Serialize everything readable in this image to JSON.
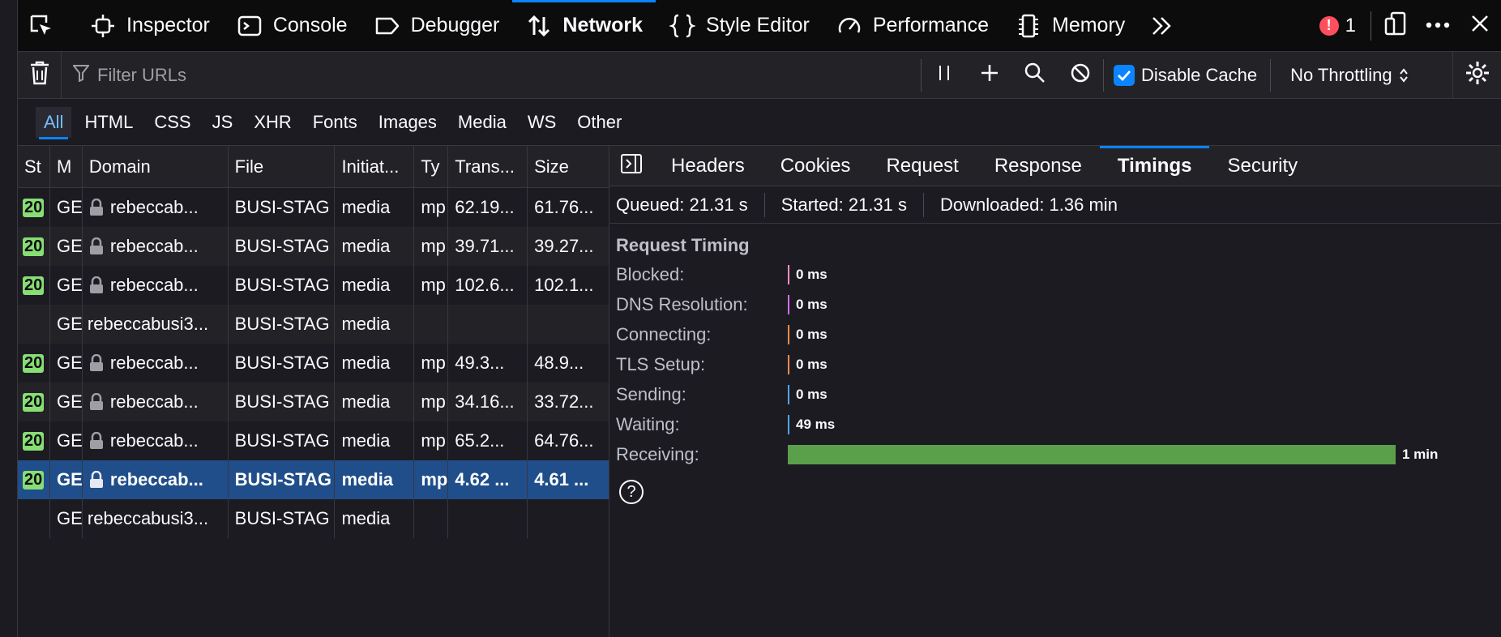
{
  "toolbar": {
    "tabs": [
      {
        "label": "Inspector",
        "icon": "inspector-icon"
      },
      {
        "label": "Console",
        "icon": "console-icon"
      },
      {
        "label": "Debugger",
        "icon": "debugger-icon"
      },
      {
        "label": "Network",
        "icon": "network-icon",
        "active": true
      },
      {
        "label": "Style Editor",
        "icon": "style-editor-icon"
      },
      {
        "label": "Performance",
        "icon": "performance-icon"
      },
      {
        "label": "Memory",
        "icon": "memory-icon"
      }
    ],
    "error_count": "1"
  },
  "filterbar": {
    "placeholder": "Filter URLs",
    "disable_cache_label": "Disable Cache",
    "disable_cache_checked": true,
    "throttling": "No Throttling"
  },
  "type_filters": [
    "All",
    "HTML",
    "CSS",
    "JS",
    "XHR",
    "Fonts",
    "Images",
    "Media",
    "WS",
    "Other"
  ],
  "table": {
    "headers": [
      "St",
      "M",
      "Domain",
      "File",
      "Initiat...",
      "Ty",
      "Trans...",
      "Size"
    ],
    "rows": [
      {
        "status": "20",
        "method": "GE",
        "secure": true,
        "domain": "rebeccab...",
        "file": "BUSI-STAG",
        "initiator": "media",
        "type": "mp",
        "transferred": "62.19...",
        "size": "61.76..."
      },
      {
        "status": "20",
        "method": "GE",
        "secure": true,
        "domain": "rebeccab...",
        "file": "BUSI-STAG",
        "initiator": "media",
        "type": "mp",
        "transferred": "39.71...",
        "size": "39.27..."
      },
      {
        "status": "20",
        "method": "GE",
        "secure": true,
        "domain": "rebeccab...",
        "file": "BUSI-STAG",
        "initiator": "media",
        "type": "mp",
        "transferred": "102.6...",
        "size": "102.1..."
      },
      {
        "status": "",
        "method": "GE",
        "secure": false,
        "domain": "rebeccabusi3...",
        "file": "BUSI-STAG",
        "initiator": "media",
        "type": "",
        "transferred": "",
        "size": ""
      },
      {
        "status": "20",
        "method": "GE",
        "secure": true,
        "domain": "rebeccab...",
        "file": "BUSI-STAG",
        "initiator": "media",
        "type": "mp",
        "transferred": "49.3...",
        "size": "48.9..."
      },
      {
        "status": "20",
        "method": "GE",
        "secure": true,
        "domain": "rebeccab...",
        "file": "BUSI-STAG",
        "initiator": "media",
        "type": "mp",
        "transferred": "34.16...",
        "size": "33.72..."
      },
      {
        "status": "20",
        "method": "GE",
        "secure": true,
        "domain": "rebeccab...",
        "file": "BUSI-STAG",
        "initiator": "media",
        "type": "mp",
        "transferred": "65.2...",
        "size": "64.76..."
      },
      {
        "status": "20",
        "method": "GE",
        "secure": true,
        "domain": "rebeccab...",
        "file": "BUSI-STAG",
        "initiator": "media",
        "type": "mp",
        "transferred": "4.62 ...",
        "size": "4.61 ...",
        "selected": true
      },
      {
        "status": "",
        "method": "GE",
        "secure": false,
        "domain": "rebeccabusi3...",
        "file": "BUSI-STAG",
        "initiator": "media",
        "type": "",
        "transferred": "",
        "size": ""
      }
    ]
  },
  "details": {
    "tabs": [
      "Headers",
      "Cookies",
      "Request",
      "Response",
      "Timings",
      "Security"
    ],
    "active_tab": "Timings",
    "summary": {
      "queued": "Queued: 21.31 s",
      "started": "Started: 21.31 s",
      "downloaded": "Downloaded: 1.36 min"
    },
    "timing_title": "Request Timing",
    "timings": [
      {
        "label": "Blocked:",
        "value": "0 ms",
        "color": "#ff8fc5",
        "fraction": 0
      },
      {
        "label": "DNS Resolution:",
        "value": "0 ms",
        "color": "#d26ef2",
        "fraction": 0
      },
      {
        "label": "Connecting:",
        "value": "0 ms",
        "color": "#ff8a4c",
        "fraction": 0
      },
      {
        "label": "TLS Setup:",
        "value": "0 ms",
        "color": "#ff8a4c",
        "fraction": 0
      },
      {
        "label": "Sending:",
        "value": "0 ms",
        "color": "#4ea6e6",
        "fraction": 0
      },
      {
        "label": "Waiting:",
        "value": "49 ms",
        "color": "#4ea6e6",
        "fraction": 0
      },
      {
        "label": "Receiving:",
        "value": "1 min",
        "color": "#5a9f4a",
        "fraction": 1
      }
    ],
    "help": "?"
  }
}
